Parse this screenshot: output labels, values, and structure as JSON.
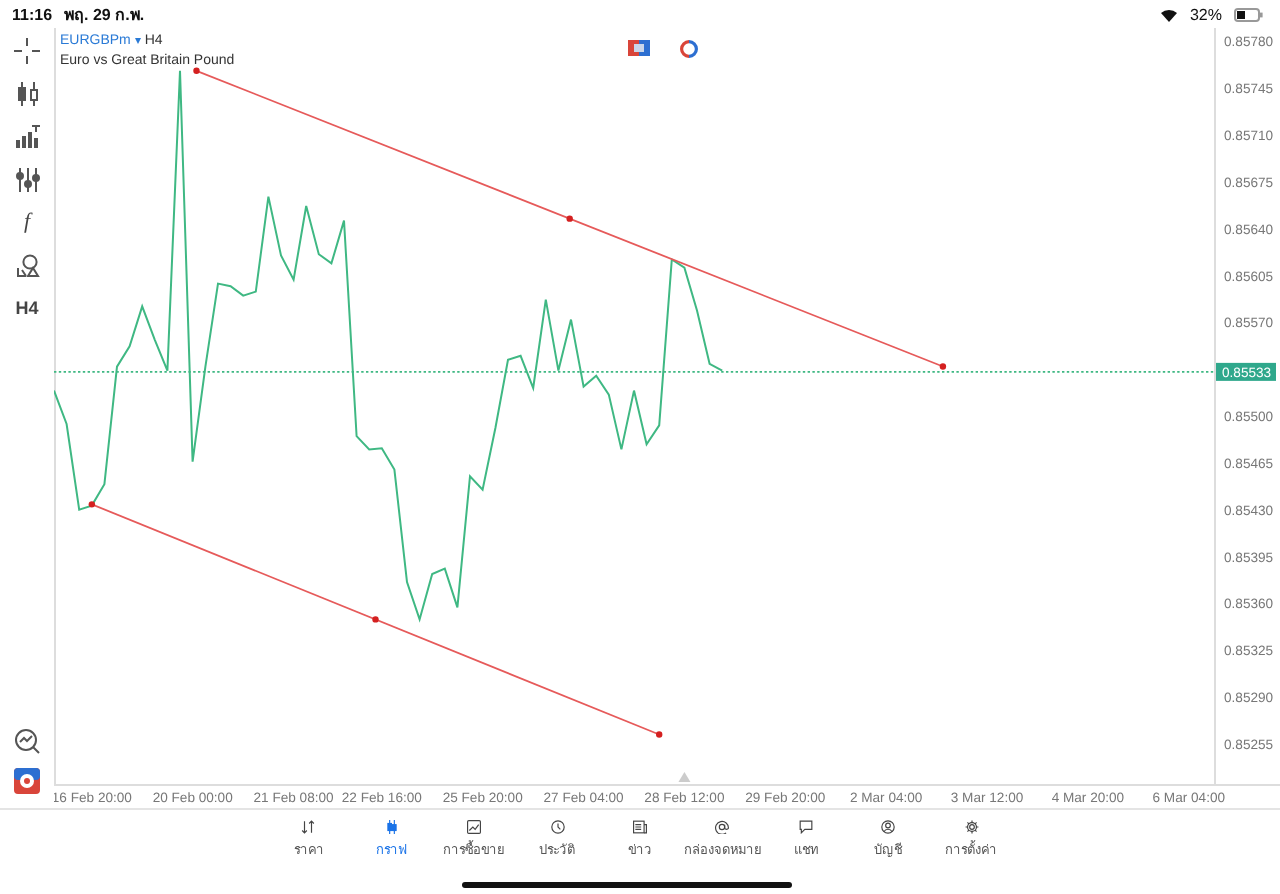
{
  "status_bar": {
    "time": "11:16",
    "date": "พฤ. 29 ก.พ.",
    "battery": "32%"
  },
  "toolbar": {
    "function_glyph": "f",
    "timeframe": "H4"
  },
  "chart_header": {
    "symbol": "EURGBPm",
    "separator": "▾",
    "timeframe": "H4",
    "description": "Euro vs Great Britain Pound"
  },
  "current_price": "0.85533",
  "chart_data": {
    "type": "line",
    "ylim": [
      0.85225,
      0.8579
    ],
    "categories": [
      null,
      null,
      null,
      "16 Feb 20:00",
      null,
      null,
      null,
      null,
      null,
      null,
      null,
      "20 Feb 00:00",
      null,
      null,
      null,
      null,
      null,
      null,
      null,
      "21 Feb 08:00",
      null,
      null,
      null,
      null,
      null,
      null,
      "22 Feb 16:00",
      null,
      null,
      null,
      null,
      null,
      null,
      null,
      "25 Feb 20:00",
      null,
      null,
      null,
      null,
      null,
      null,
      null,
      "27 Feb 04:00",
      null,
      null,
      null,
      null,
      null,
      null,
      null,
      "28 Feb 12:00",
      null,
      null,
      null,
      null,
      null,
      null,
      null,
      "29 Feb 20:00",
      null,
      null,
      null,
      null,
      null,
      null,
      null,
      "2 Mar 04:00",
      null,
      null,
      null,
      null,
      null,
      null,
      null,
      "3 Mar 12:00",
      null,
      null,
      null,
      null,
      null,
      null,
      null,
      "4 Mar 20:00",
      null,
      null,
      null,
      null,
      null,
      null,
      null,
      "6 Mar 04:00",
      null,
      null
    ],
    "yticks": [
      {
        "value": 0.8578,
        "label": "0.85780"
      },
      {
        "value": 0.85745,
        "label": "0.85745"
      },
      {
        "value": 0.8571,
        "label": "0.85710"
      },
      {
        "value": 0.85675,
        "label": "0.85675"
      },
      {
        "value": 0.8564,
        "label": "0.85640"
      },
      {
        "value": 0.85605,
        "label": "0.85605"
      },
      {
        "value": 0.8557,
        "label": "0.85570"
      },
      {
        "value": 0.855,
        "label": "0.85500"
      },
      {
        "value": 0.85465,
        "label": "0.85465"
      },
      {
        "value": 0.8543,
        "label": "0.85430"
      },
      {
        "value": 0.85395,
        "label": "0.85395"
      },
      {
        "value": 0.8536,
        "label": "0.85360"
      },
      {
        "value": 0.85325,
        "label": "0.85325"
      },
      {
        "value": 0.8529,
        "label": "0.85290"
      },
      {
        "value": 0.85255,
        "label": "0.85255"
      }
    ],
    "series": [
      {
        "color": "#3fb883",
        "values": [
          0.85519,
          0.85494,
          0.8543,
          0.85433,
          0.85449,
          0.85537,
          0.85552,
          0.85582,
          0.85557,
          0.85534,
          0.85758,
          0.85466,
          0.85537,
          0.85599,
          0.85597,
          0.8559,
          0.85593,
          0.85664,
          0.8562,
          0.85602,
          0.85657,
          0.85621,
          0.85614,
          0.85646,
          0.85485,
          0.85475,
          0.85476,
          0.8546,
          0.85376,
          0.85348,
          0.85382,
          0.85386,
          0.85357,
          0.85455,
          0.85445,
          0.85491,
          0.85542,
          0.85545,
          0.85521,
          0.85587,
          0.85534,
          0.85572,
          0.85522,
          0.8553,
          0.85516,
          0.85475,
          0.85519,
          0.85479,
          0.85493,
          0.85617,
          0.85611,
          0.85579,
          0.85539,
          0.85534,
          null,
          null,
          null,
          null,
          null,
          null,
          null,
          null,
          null,
          null,
          null,
          null,
          null,
          null,
          null,
          null,
          null,
          null,
          null,
          null,
          null,
          null,
          null,
          null,
          null,
          null,
          null,
          null,
          null,
          null,
          null,
          null,
          null,
          null,
          null,
          null,
          null,
          null,
          null
        ]
      }
    ]
  },
  "nav": {
    "items": [
      {
        "label": "ราคา",
        "selected": false
      },
      {
        "label": "กราฟ",
        "selected": true
      },
      {
        "label": "การซื้อขาย",
        "selected": false
      },
      {
        "label": "ประวัติ",
        "selected": false
      },
      {
        "label": "ข่าว",
        "selected": false
      },
      {
        "label": "กล่องจดหมาย",
        "selected": false
      },
      {
        "label": "แชท",
        "selected": false
      },
      {
        "label": "บัญชี",
        "selected": false
      },
      {
        "label": "การตั้งค่า",
        "selected": false
      }
    ]
  }
}
